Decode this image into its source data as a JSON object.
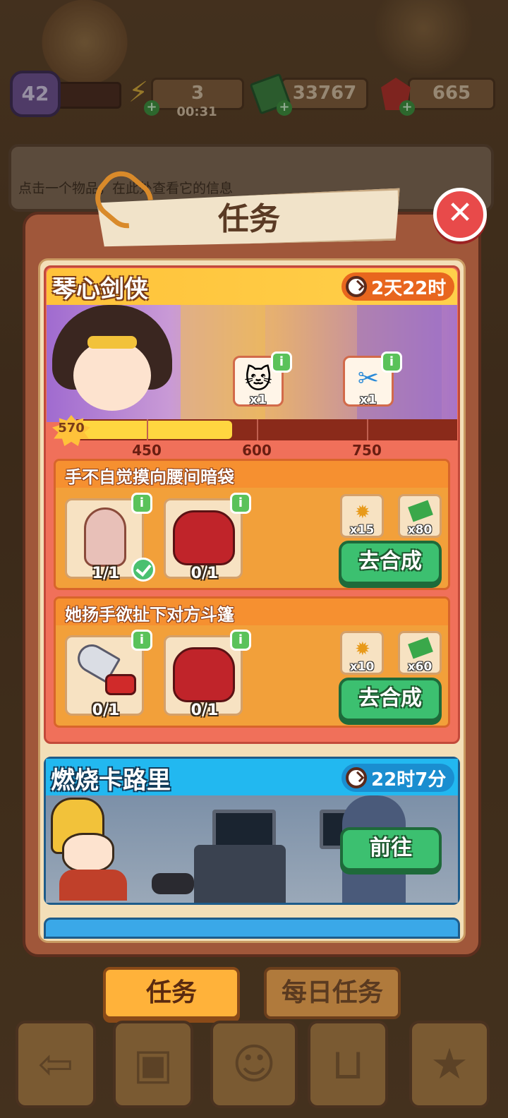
{
  "hud": {
    "level": "42",
    "energy": "3",
    "energy_timer": "00:31",
    "cash": "33767",
    "gems": "665"
  },
  "info_panel": {
    "hint": "点击一个物品，在此处查看它的信息"
  },
  "modal": {
    "title": "任务",
    "close_icon": "close-icon"
  },
  "events": [
    {
      "name": "琴心剑侠",
      "timer": "2天22时",
      "points": "570",
      "progress_fraction": 0.41,
      "milestones": [
        "450",
        "600",
        "750"
      ],
      "rewards": [
        {
          "icon": "lucky-cat-icon",
          "qty": "x1"
        },
        {
          "icon": "scissors-badge-icon",
          "qty": "x1"
        }
      ],
      "tasks": [
        {
          "title": "手不自觉摸向腰间暗袋",
          "items": [
            {
              "icon": "vase-icon",
              "count": "1/1",
              "done": true
            },
            {
              "icon": "gloves-icon",
              "count": "0/1",
              "done": false
            }
          ],
          "rewards": [
            {
              "icon": "star-point-icon",
              "qty": "x15"
            },
            {
              "icon": "cash-stack-icon",
              "qty": "x80"
            }
          ],
          "button": "去合成"
        },
        {
          "title": "她扬手欲扯下对方斗篷",
          "items": [
            {
              "icon": "shears-icon",
              "count": "0/1",
              "done": false
            },
            {
              "icon": "gloves-icon",
              "count": "0/1",
              "done": false
            }
          ],
          "rewards": [
            {
              "icon": "star-point-icon",
              "qty": "x10"
            },
            {
              "icon": "cash-stack-icon",
              "qty": "x60"
            }
          ],
          "button": "去合成"
        }
      ]
    },
    {
      "name": "燃烧卡路里",
      "timer": "22时7分",
      "button": "前往"
    }
  ],
  "tabs": {
    "tasks": "任务",
    "daily": "每日任务"
  },
  "colors": {
    "accent_orange": "#ffb23a",
    "button_green": "#3cc070",
    "close_red": "#e84a4a",
    "event_blue": "#22b8f0"
  }
}
